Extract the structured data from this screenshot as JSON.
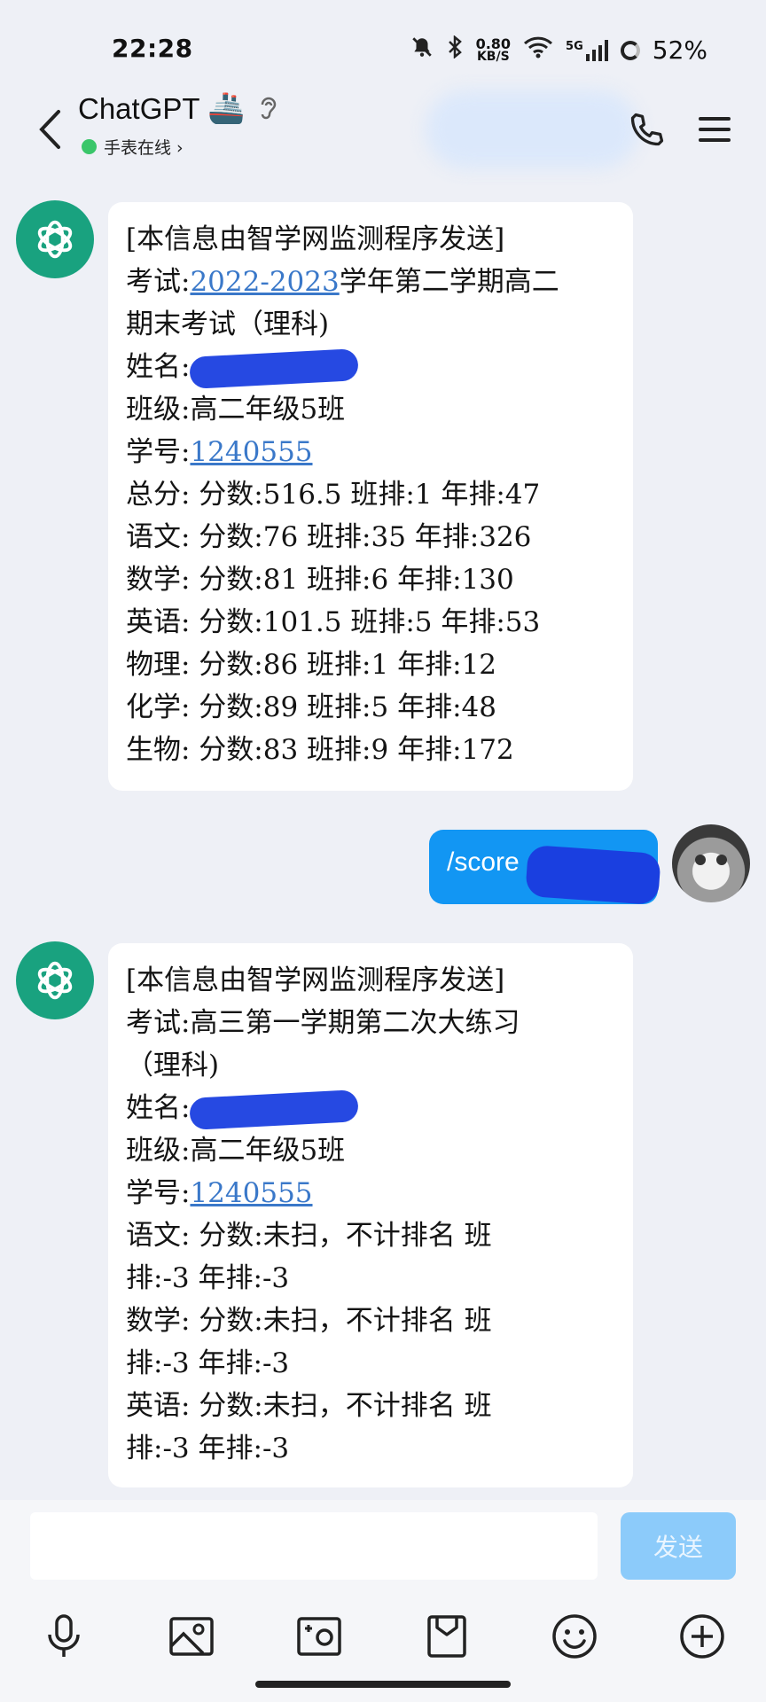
{
  "status_bar": {
    "time": "22:28",
    "net_speed_value": "0.80",
    "net_speed_unit": "KB/S",
    "signal_label": "5G",
    "battery": "52%"
  },
  "header": {
    "title": "ChatGPT",
    "title_emoji": "🚢",
    "online_status": "手表在线 ›"
  },
  "messages": [
    {
      "sender": "bot",
      "lines": [
        {
          "text": "[本信息由智学网监测程序发送]"
        },
        {
          "prefix": "考试:",
          "link": "2022-2023",
          "text": "学年第二学期高二"
        },
        {
          "text": "期末考试（理科)"
        },
        {
          "prefix": "姓名:",
          "redacted": true
        },
        {
          "text": "班级:高二年级5班"
        },
        {
          "prefix": "学号:",
          "link": "1240555"
        },
        {
          "text": "总分: 分数:516.5 班排:1 年排:47"
        },
        {
          "text": "语文: 分数:76 班排:35 年排:326"
        },
        {
          "text": "数学: 分数:81 班排:6 年排:130"
        },
        {
          "text": "英语: 分数:101.5 班排:5 年排:53"
        },
        {
          "text": "物理: 分数:86 班排:1 年排:12"
        },
        {
          "text": "化学: 分数:89 班排:5 年排:48"
        },
        {
          "text": "生物: 分数:83 班排:9 年排:172"
        }
      ]
    },
    {
      "sender": "user",
      "text": "/score"
    },
    {
      "sender": "bot",
      "lines": [
        {
          "text": "[本信息由智学网监测程序发送]"
        },
        {
          "text": "考试:高三第一学期第二次大练习"
        },
        {
          "text": "（理科)"
        },
        {
          "prefix": "姓名:",
          "redacted": true
        },
        {
          "text": "班级:高二年级5班"
        },
        {
          "prefix": "学号:",
          "link": "1240555"
        },
        {
          "text": "语文: 分数:未扫，不计排名 班"
        },
        {
          "text": "排:-3 年排:-3"
        },
        {
          "text": "数学: 分数:未扫，不计排名 班"
        },
        {
          "text": "排:-3 年排:-3"
        },
        {
          "text": "英语: 分数:未扫，不计排名 班"
        },
        {
          "text": "排:-3 年排:-3"
        }
      ]
    }
  ],
  "input": {
    "value": "",
    "send_label": "发送"
  },
  "toolbar": {
    "icons": [
      "microphone-icon",
      "image-icon",
      "camera-icon",
      "folder-icon",
      "emoji-icon",
      "plus-icon"
    ]
  },
  "colors": {
    "background": "#eef0f6",
    "bot_avatar": "#19a27f",
    "user_bubble": "#1296f3",
    "link": "#3a78c9",
    "send_button_disabled": "#8ccbfa",
    "online_dot": "#3ac66a"
  }
}
